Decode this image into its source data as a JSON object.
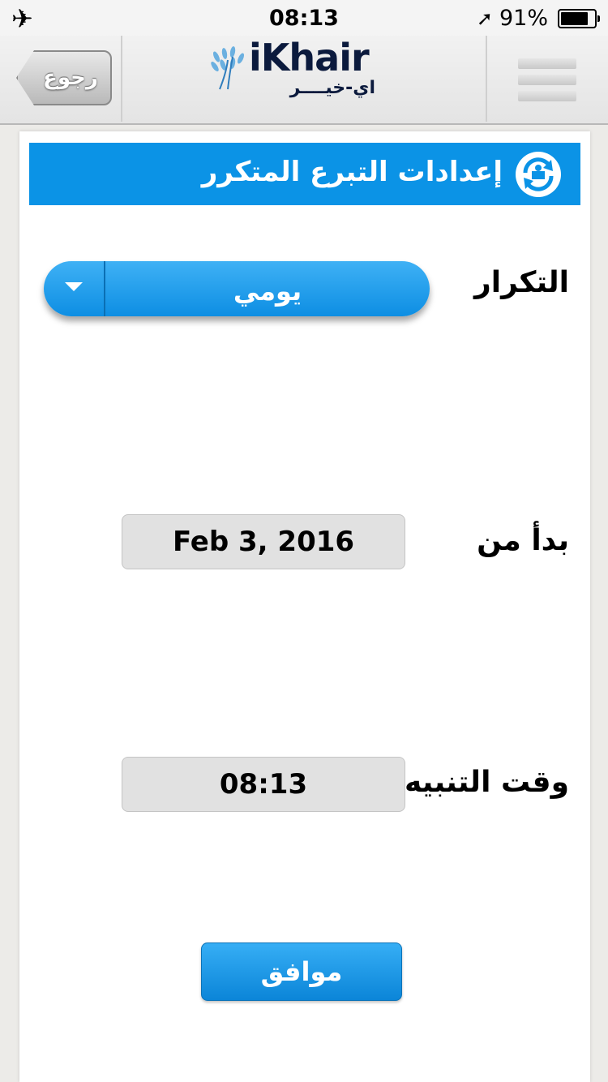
{
  "status_bar": {
    "time": "08:13",
    "battery": "91%",
    "battery_level": 0.91
  },
  "nav": {
    "back_label": "رجوع",
    "logo_text": "iKhair",
    "logo_subtext": "اي-خيــــر",
    "menu_icon": "hamburger-menu-icon"
  },
  "section": {
    "title": "إعدادات التبرع المتكرر",
    "icon": "recurring-donation-icon"
  },
  "form": {
    "frequency_label": "التكرار",
    "frequency_value": "يومي",
    "start_label": "بدأ من",
    "start_value": "Feb 3, 2016",
    "alarm_label": "وقت التنبيه",
    "alarm_value": "08:13",
    "ok_label": "موافق"
  },
  "colors": {
    "accent": "#0b93e6",
    "field_bg": "#e1e1e1"
  }
}
